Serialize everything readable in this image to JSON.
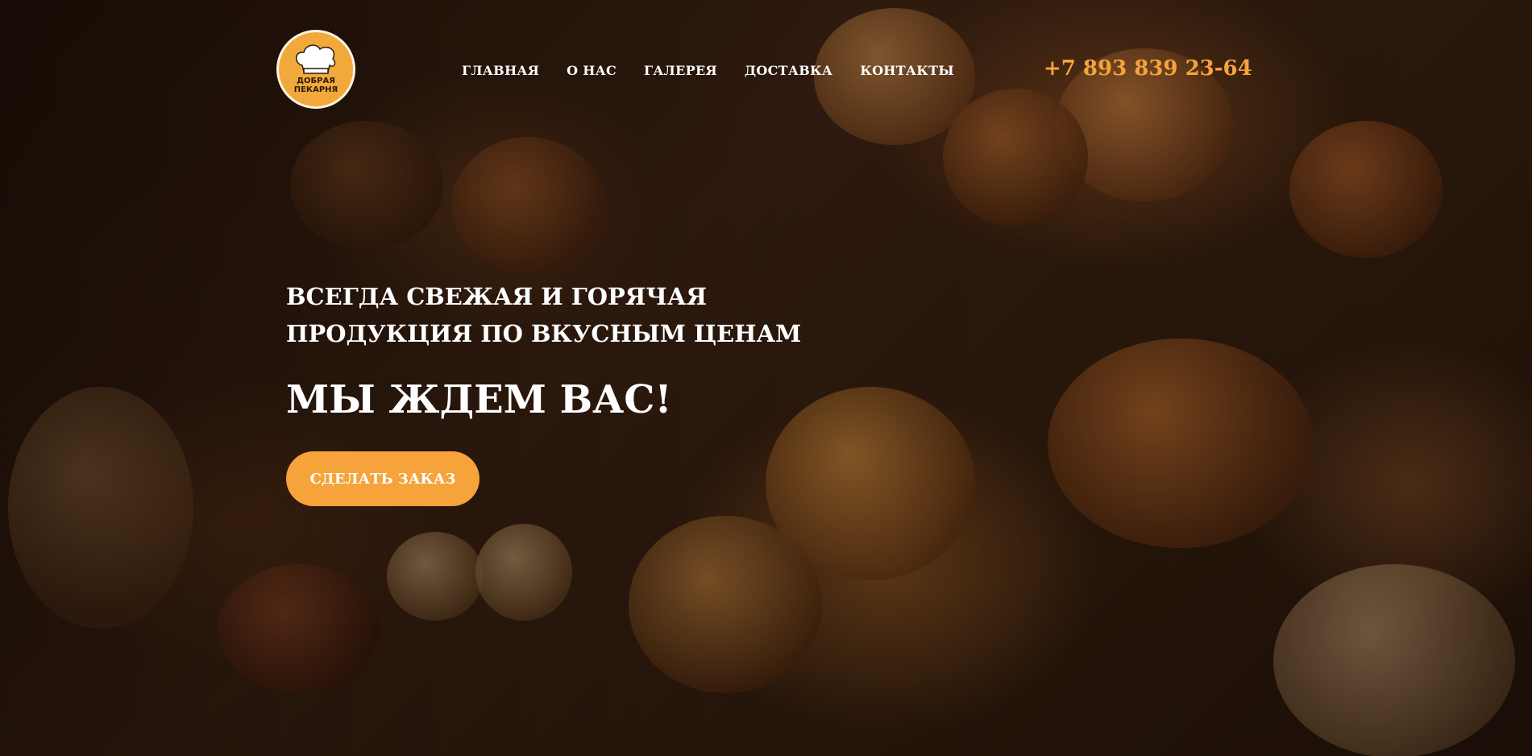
{
  "brand": {
    "logo_text_line1": "Добрая",
    "logo_text_line2": "Пекарня"
  },
  "nav": {
    "items": [
      {
        "label": "ГЛАВНАЯ"
      },
      {
        "label": "О НАС"
      },
      {
        "label": "ГАЛЕРЕЯ"
      },
      {
        "label": "ДОСТАВКА"
      },
      {
        "label": "КОНТАКТЫ"
      }
    ]
  },
  "phone": "+7 893 839 23-64",
  "hero": {
    "tagline_line1": "ВСЕГДА СВЕЖАЯ И ГОРЯЧАЯ",
    "tagline_line2": "ПРОДУКЦИЯ ПО ВКУСНЫМ ЦЕНАМ",
    "headline": "МЫ ЖДЕМ ВАС!",
    "cta_label": "СДЕЛАТЬ ЗАКАЗ",
    "background_image": "bakery-bread-icon"
  },
  "colors": {
    "accent": "#f5a33a",
    "text": "#ffffff",
    "background": "#2a160a"
  }
}
